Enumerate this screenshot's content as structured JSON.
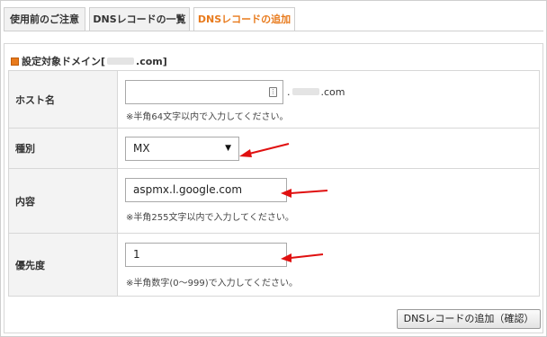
{
  "tabs": [
    {
      "label": "使用前のご注意",
      "active": false
    },
    {
      "label": "DNSレコードの一覧",
      "active": false
    },
    {
      "label": "DNSレコードの追加",
      "active": true
    }
  ],
  "panel": {
    "title_prefix": "設定対象ドメイン[",
    "title_suffix": ".com]"
  },
  "form": {
    "host": {
      "label": "ホスト名",
      "value": "",
      "domain_suffix": ".com",
      "note": "※半角64文字以内で入力してください。"
    },
    "type": {
      "label": "種別",
      "selected": "MX",
      "caret": "▼"
    },
    "content": {
      "label": "内容",
      "value": "aspmx.l.google.com",
      "note": "※半角255文字以内で入力してください。"
    },
    "priority": {
      "label": "優先度",
      "value": "1",
      "note": "※半角数字(0～999)で入力してください。"
    }
  },
  "submit_label": "DNSレコードの追加（確認）",
  "colors": {
    "accent": "#e87a1c",
    "annotation_arrow": "#e01010",
    "label_bg": "#f3f3f3"
  },
  "icons": {
    "host_field": "key-icon",
    "select": "caret-down-icon",
    "title": "square-bullet-icon"
  }
}
